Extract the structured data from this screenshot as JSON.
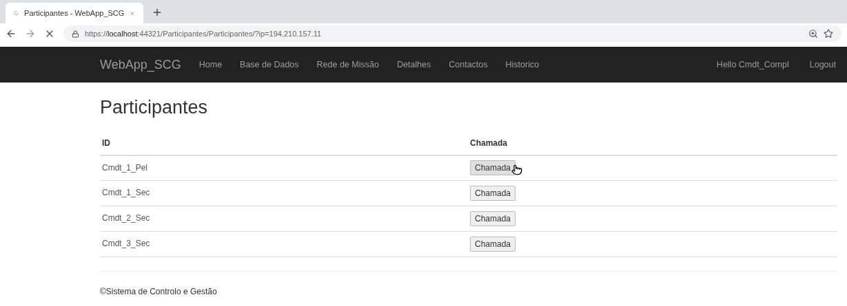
{
  "browser": {
    "tab": {
      "title": "Participantes - WebApp_SCG",
      "loading": true
    },
    "url": "https://**localhost**:44321/Participantes/Participantes/?ip=194.210.157.11"
  },
  "navbar": {
    "brand": "WebApp_SCG",
    "links": [
      "Home",
      "Base de Dados",
      "Rede de Missão",
      "Detalhes",
      "Contactos",
      "Historico"
    ],
    "user": "Hello Cmdt_Compl",
    "logout": "Logout"
  },
  "page": {
    "title": "Participantes"
  },
  "table": {
    "columns": [
      "ID",
      "Chamada"
    ],
    "rows": [
      {
        "id": "Cmdt_1_Pel",
        "button": "Chamada",
        "hovered": true
      },
      {
        "id": "Cmdt_1_Sec",
        "button": "Chamada",
        "hovered": false
      },
      {
        "id": "Cmdt_2_Sec",
        "button": "Chamada",
        "hovered": false
      },
      {
        "id": "Cmdt_3_Sec",
        "button": "Chamada",
        "hovered": false
      }
    ]
  },
  "footer": "©Sistema de Controlo e Gestão"
}
